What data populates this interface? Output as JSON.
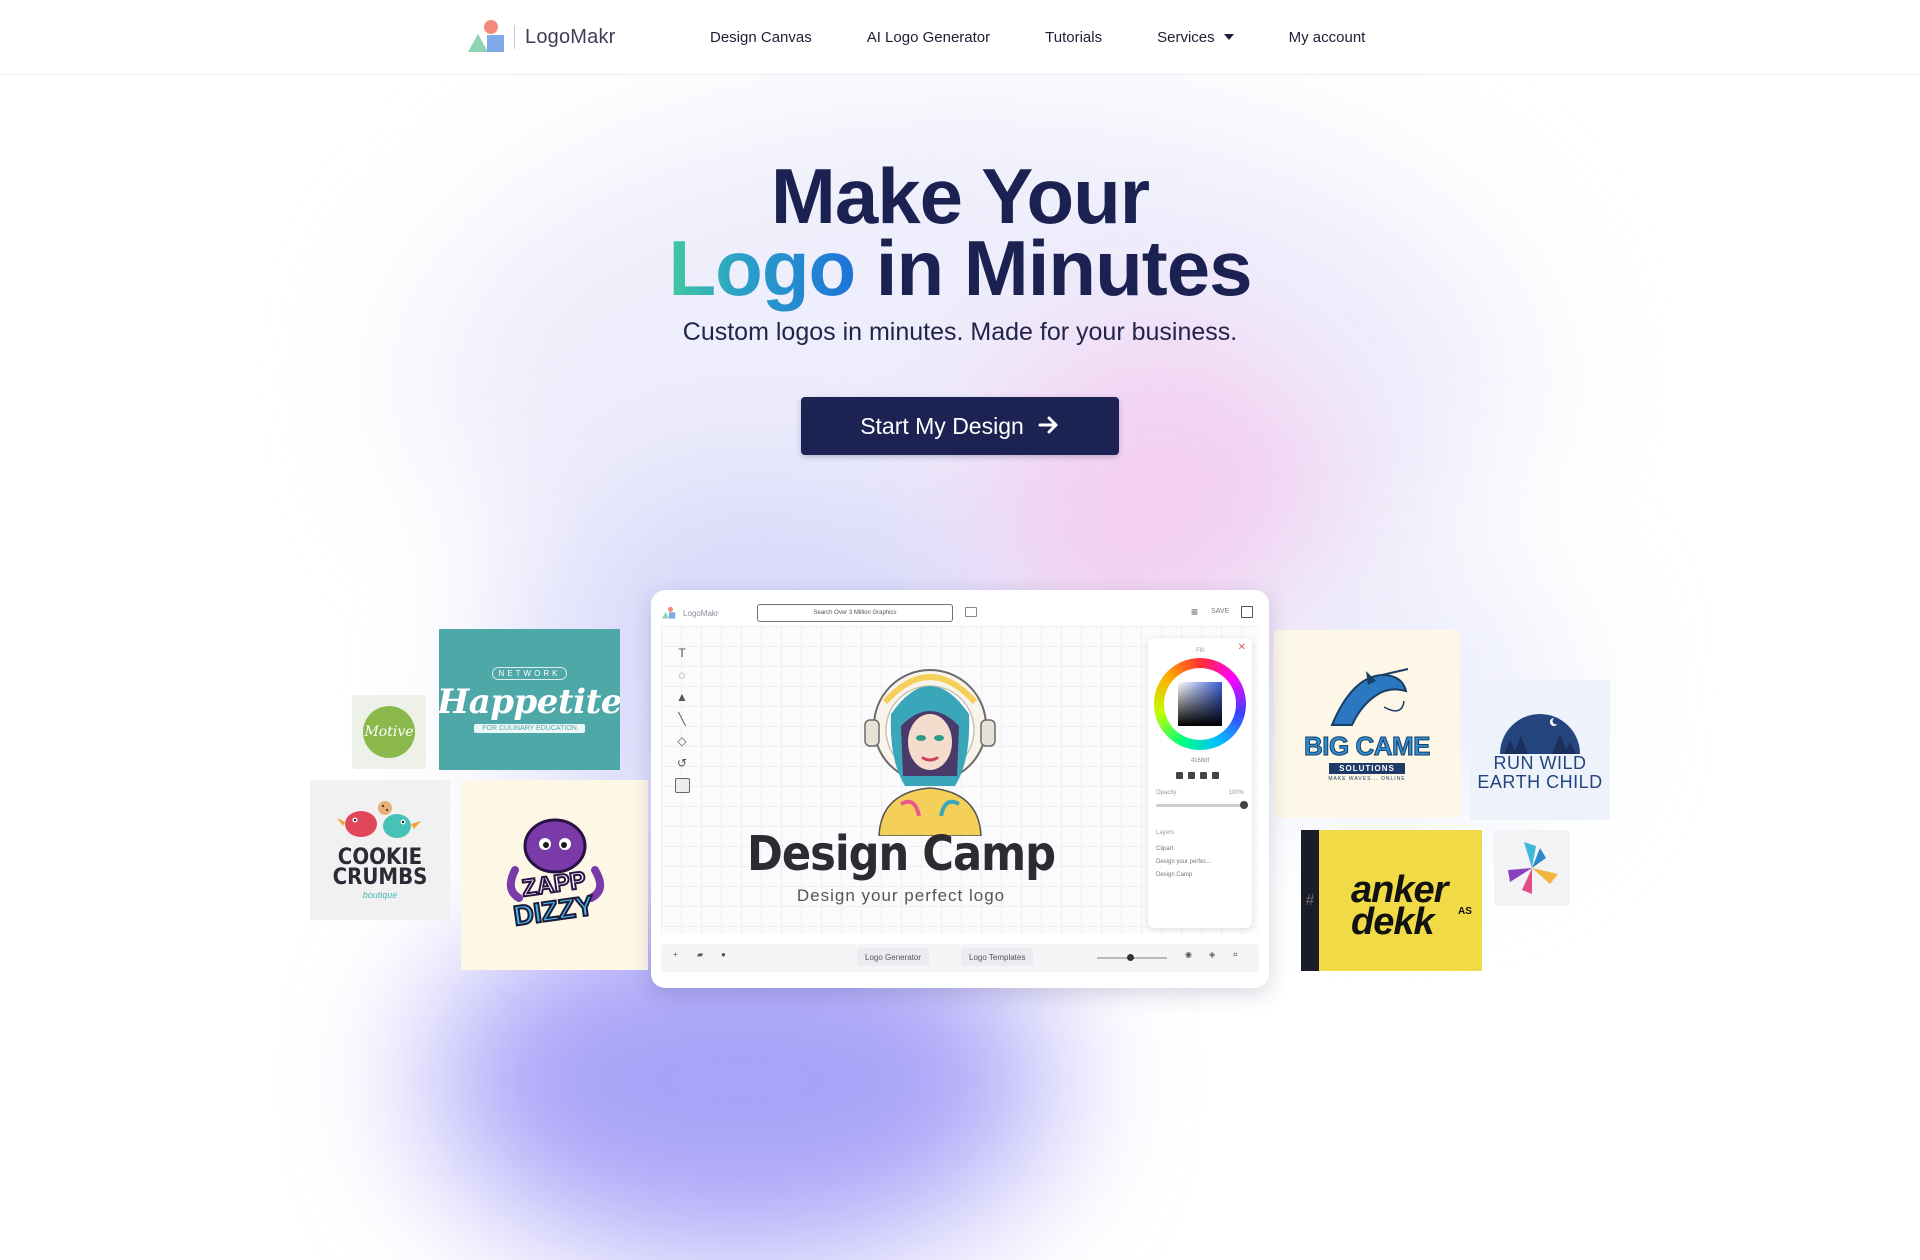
{
  "nav": {
    "brand": "LogoMakr",
    "links": [
      "Design Canvas",
      "AI Logo Generator",
      "Tutorials",
      "Services",
      "My account"
    ]
  },
  "hero": {
    "title_line1": "Make Your",
    "title_line2_highlight": "Logo",
    "title_line2_rest": "in Minutes",
    "subtitle": "Custom logos in minutes. Made for your business.",
    "cta_label": "Start My Design",
    "cta_icon": "arrow-right-icon"
  },
  "showcase": {
    "motive": "Motive",
    "happetite": {
      "top": "NETWORK",
      "name": "Happetite",
      "ribbon": "FOR CULINARY EDUCATION"
    },
    "cookie": {
      "name_line1": "COOKIE",
      "name_line2": "CRUMBS",
      "sub": "boutique"
    },
    "zapp": {
      "line1": "ZAPP",
      "line2": "DIZZY"
    },
    "bigcame": {
      "name": "BIG CAME",
      "ribbon": "SOLUTIONS",
      "tag": "MAKE WAVES... ONLINE"
    },
    "runwild": {
      "line1": "RUN WILD",
      "line2": "EARTH CHILD"
    },
    "anker": {
      "line1": "anker",
      "line2": "dekk",
      "suffix": "AS",
      "strip": "#"
    }
  },
  "editor": {
    "brand": "LogoMakr",
    "search_placeholder": "Search Over 3 Million Graphics",
    "save_label": "SAVE",
    "logo_title": "Design Camp",
    "logo_subtitle": "Design your perfect logo",
    "panel": {
      "fill_label": "Fill",
      "hex": "4168df",
      "opacity_label": "Opacity",
      "opacity_value": "100%",
      "layers_label": "Layers",
      "layers": [
        "Clipart",
        "Design your perfec...",
        "Design Camp"
      ]
    },
    "bottom": {
      "ai_label": "Logo Generator",
      "templates_label": "Logo Templates"
    }
  },
  "colors": {
    "navy": "#1c2352",
    "accent_green": "#40c8a0",
    "accent_blue": "#1e73d8"
  }
}
